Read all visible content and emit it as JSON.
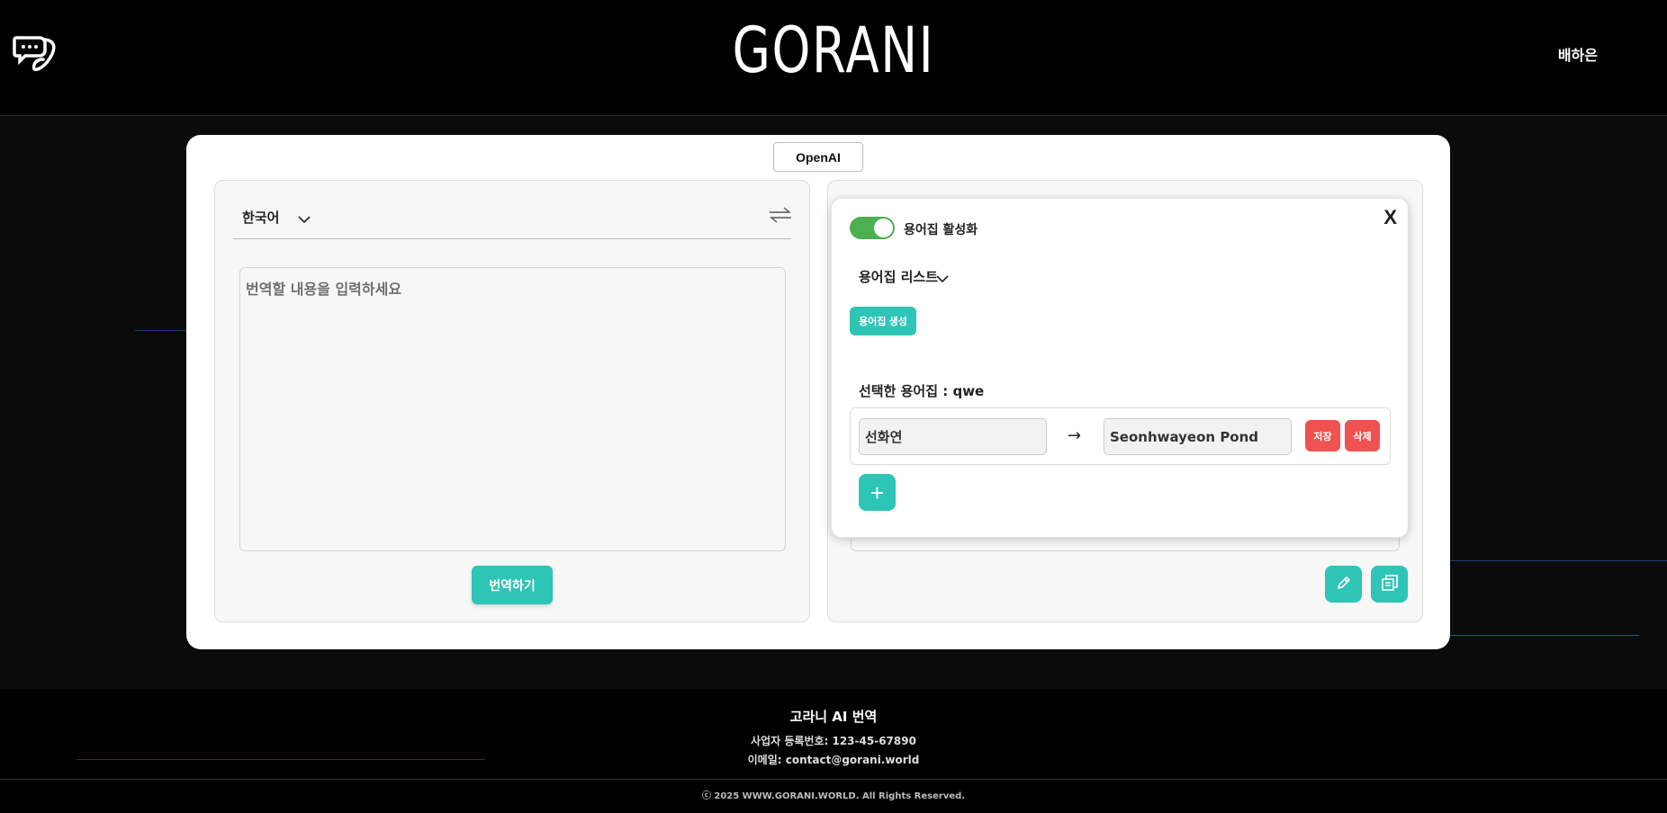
{
  "header": {
    "brand": "GORANI",
    "user_name": "배하은"
  },
  "card": {
    "model_button": "OpenAI",
    "source": {
      "language": "한국어",
      "placeholder": "번역할 내용을 입력하세요",
      "translate_button": "번역하기"
    }
  },
  "glossary": {
    "close_label": "X",
    "toggle_label": "용어집 활성화",
    "toggle_on": true,
    "list_label": "용어집 리스트",
    "create_button": "용어집 생성",
    "selected_label": "선택한 용어집 : qwe",
    "entries": [
      {
        "source": "선화연",
        "target": "Seonhwayeon Pond"
      }
    ],
    "arrow": "→",
    "save_button": "저장",
    "delete_button": "삭제",
    "add_button": "+"
  },
  "footer": {
    "title": "고라니 AI 번역",
    "business_number": "사업자 등록번호: 123-45-67890",
    "email": "이메일: contact@gorani.world",
    "copyright": "ⓒ 2025 WWW.GORANI.WORLD. All Rights Reserved."
  },
  "colors": {
    "accent": "#2ec4b6",
    "danger": "#f05151",
    "toggle_on": "#4caf50",
    "background": "#0b0b0c"
  }
}
